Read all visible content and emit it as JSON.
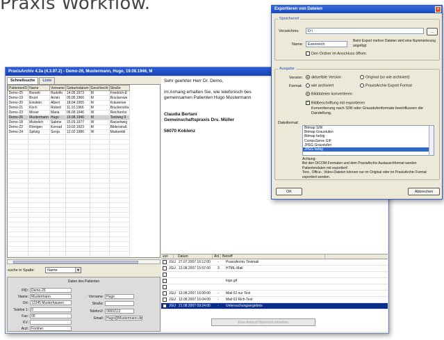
{
  "heading": "Praxis Workflow.",
  "window": {
    "title": "PraxisArchiv 4.3a (4.3.97.2) - Demo-26, Mustermann, Hugo, 19.08.1946, M",
    "tabs": [
      "Schnellsuche",
      "Liste"
    ],
    "columns": [
      "PatientenID",
      "Name",
      "Vorname",
      "Geburtsdatum",
      "Geschlecht",
      "Straße"
    ],
    "rows": [
      [
        "Demo-25",
        "Bonetti",
        "Rudolfo",
        "14.05.1973",
        "M",
        "Friedrich-E"
      ],
      [
        "Demo-19",
        "Brunt",
        "Armin",
        "05.05.1966",
        "M",
        "Bruckenwe"
      ],
      [
        "Demo-20",
        "Einstein",
        "Albert",
        "18.04.1955",
        "M",
        "Kräuterwe"
      ],
      [
        "Demo-21",
        "Koch",
        "Robert",
        "11.10.1966",
        "M",
        "Bruckenstra"
      ],
      [
        "Demo-23",
        "Moser",
        "Maria",
        "06.09.1946",
        "W",
        "Reichenho"
      ],
      [
        "Demo-26",
        "Mustermann",
        "Hugo",
        "19.08.1946",
        "M",
        "Testweg 9"
      ],
      [
        "Demo-18",
        "Muttelich",
        "Sabine",
        "15.03.1977",
        "W",
        "Rasselweg"
      ],
      [
        "Demo-22",
        "Röntgen",
        "Konrad",
        "10.02.1923",
        "M",
        "Bilderstraß"
      ],
      [
        "Demo-24",
        "Spitzig",
        "Sonja",
        "12.02.1986",
        "W",
        "Markenbli"
      ]
    ],
    "selected_row": 5,
    "search_label": "suche in Spalte:",
    "search_value": "Name",
    "details_title": "Daten des Patienten",
    "fields": {
      "pid_label": "PID:",
      "pid": "Demo-26",
      "name_label": "Name:",
      "name": "Mustermann",
      "ort_label": "Ort:",
      "ort": "12345 Musterhausen",
      "tel_label": "Telefon 1:",
      "tel": "0",
      "fax_label": "Fax:",
      "fax": "00",
      "kv_label": "KV:",
      "kv": "",
      "arzt_label": "Arzt:",
      "arzt": "Fontner",
      "vorname_label": "Vorname:",
      "vorname": "Hugo",
      "strasse_label": "Straße:",
      "strasse": "",
      "tel2_label": "Telefon2:",
      "tel2": "0000/112",
      "email_label": "Email:",
      "email": "Hugo@Mustermann.de"
    },
    "letter": {
      "greeting": "Sehr geehrter Herr Dr. Demo,",
      "body1": "im Anhang erhalten Sie, wie telefonisch bes",
      "body2": "gemeinsamen Patienten Hugo Mustermann",
      "sig1": "Claudia Bertani",
      "sig2": "Gemeinschaftspraxis Drs. Müller",
      "sig3": "56070 Koblenz"
    },
    "mail_columns": [
      "von",
      "Datum",
      "Anl.",
      "Betreff"
    ],
    "mails": [
      {
        "von": "JGU",
        "datum": "27.07.2007 16:12:00",
        "anl": "-",
        "betreff": "PraxisArchiv Testmail"
      },
      {
        "von": "JGU",
        "datum": "13.08.2007 15:57:00",
        "anl": "3",
        "betreff": "HTML-Mail"
      },
      {
        "von": "",
        "datum": "",
        "anl": "",
        "betreff": ""
      },
      {
        "von": "",
        "datum": "",
        "anl": "",
        "betreff": "logo.gif"
      },
      {
        "von": "",
        "datum": "",
        "anl": "",
        "betreff": ""
      },
      {
        "von": "JGU",
        "datum": "13.08.2007 16:00:00",
        "anl": "-",
        "betreff": "Mail 02 nur Text"
      },
      {
        "von": "JGU",
        "datum": "13.08.2007 16:04:00",
        "anl": "-",
        "betreff": "Mail 03 Rich-Text"
      },
      {
        "von": "JGU",
        "datum": "21.08.2007 09:24:00",
        "anl": "-",
        "betreff": "Untersuchungsergebnis"
      }
    ],
    "selected_mail": 7,
    "mail_button": "Eine Antwort Nachricht einsehen"
  },
  "dialog": {
    "title": "Exportieren von Dateien",
    "speicherort_label": "Speicherort",
    "verzeichnis_label": "Verzeichnis:",
    "verzeichnis": "D:\\",
    "browse": "...",
    "name_label": "Name:",
    "name": "Exenreich",
    "name_hint": "Beim Export mehrer Dateien wird eine Nummerierung angefügt",
    "ordner_label": "Den Ordner im Anschluss öffnen",
    "ausgabe_label": "Ausgabe",
    "version_label": "Version:",
    "version_opt1": "aktuellste Version",
    "version_opt2": "Original (so wie archiviert)",
    "format_label": "Format:",
    "format_opt1": "wie archiviert",
    "format_opt2": "PraxisArchiv Export Format",
    "format_opt3": "Bilddateien konvertieren",
    "beschriftung_label": "Bildbeschriftung mit exportieren",
    "beschriftung_hint": "Konvertierung nach S/W oder Graustufenformate beeinflussen die Darstellung.",
    "dateiformat_label": "Dateiformat:",
    "formats": [
      "Bitmap S/W",
      "Bitmap Graustufen",
      "Bitmap farbig",
      "CompuServe GIF",
      "JPEG Graustufen",
      "JPEG farbig"
    ],
    "selected_format": 5,
    "note": "Achtung:\nBei den DICOM-Formaten und dem PraxisArchiv Austauschformat werden Patientendaten mit exportiert!\nText-, Office-, Video-Dateien können nur im Original oder im PraxisArchiv Format exportiert werden.",
    "ok": "OK",
    "cancel": "Abbrechen"
  }
}
